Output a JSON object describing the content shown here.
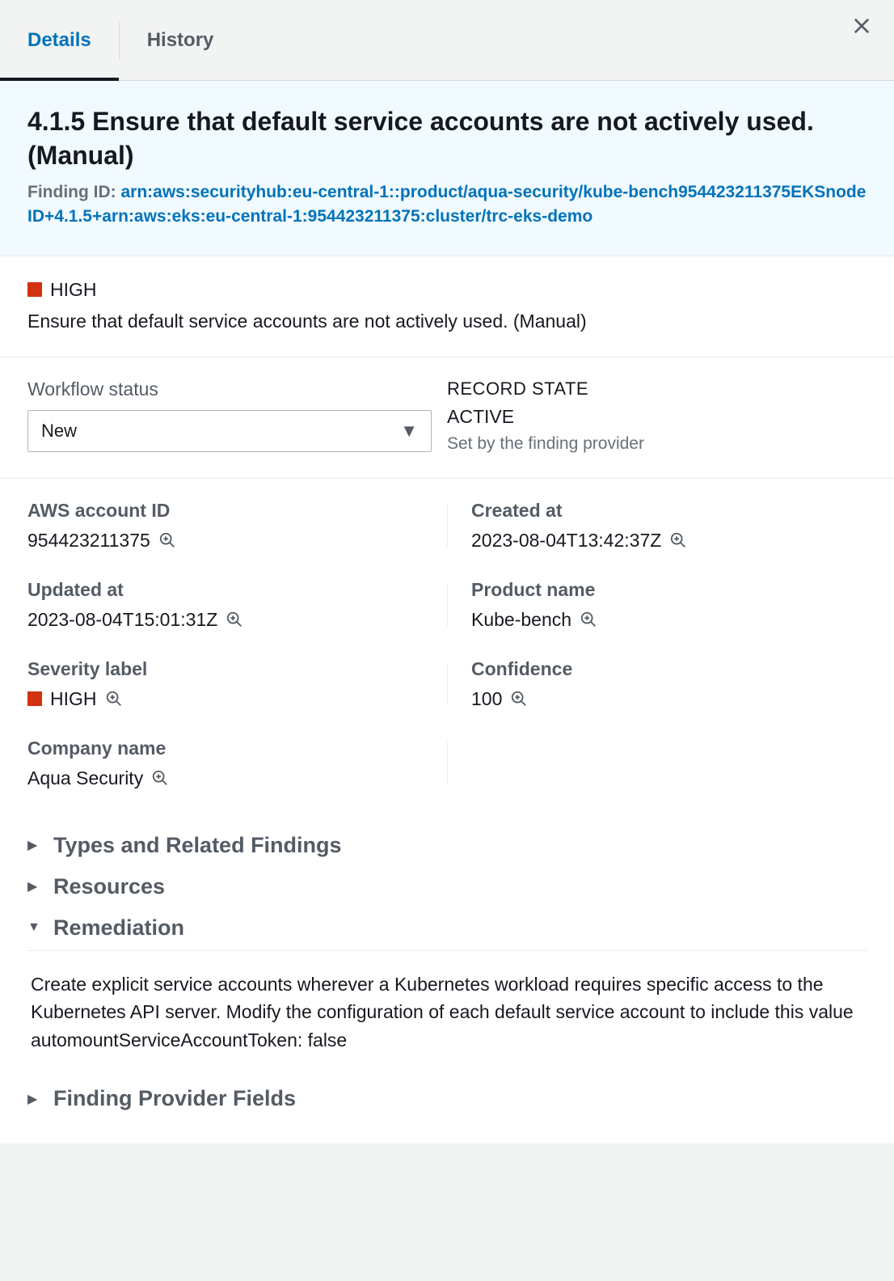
{
  "tabs": {
    "details": "Details",
    "history": "History"
  },
  "header": {
    "title": "4.1.5 Ensure that default service accounts are not actively used. (Manual)",
    "finding_id_label": "Finding ID: ",
    "finding_id_value": "arn:aws:securityhub:eu-central-1::product/aqua-security/kube-bench954423211375EKSnodeID+4.1.5+arn:aws:eks:eu-central-1:954423211375:cluster/trc-eks-demo"
  },
  "severity": {
    "level": "HIGH",
    "description": "Ensure that default service accounts are not actively used. (Manual)"
  },
  "workflow": {
    "label": "Workflow status",
    "selected": "New"
  },
  "record_state": {
    "heading": "RECORD STATE",
    "value": "ACTIVE",
    "sub": "Set by the finding provider"
  },
  "fields": {
    "aws_account_id": {
      "label": "AWS account ID",
      "value": "954423211375"
    },
    "created_at": {
      "label": "Created at",
      "value": "2023-08-04T13:42:37Z"
    },
    "updated_at": {
      "label": "Updated at",
      "value": "2023-08-04T15:01:31Z"
    },
    "product_name": {
      "label": "Product name",
      "value": "Kube-bench"
    },
    "severity_label": {
      "label": "Severity label",
      "value": "HIGH"
    },
    "confidence": {
      "label": "Confidence",
      "value": "100"
    },
    "company_name": {
      "label": "Company name",
      "value": "Aqua Security"
    }
  },
  "expanders": {
    "types": "Types and Related Findings",
    "resources": "Resources",
    "remediation": "Remediation",
    "remediation_body": "Create explicit service accounts wherever a Kubernetes workload requires specific access to the Kubernetes API server. Modify the configuration of each default service account to include this value automountServiceAccountToken: false",
    "provider": "Finding Provider Fields"
  }
}
